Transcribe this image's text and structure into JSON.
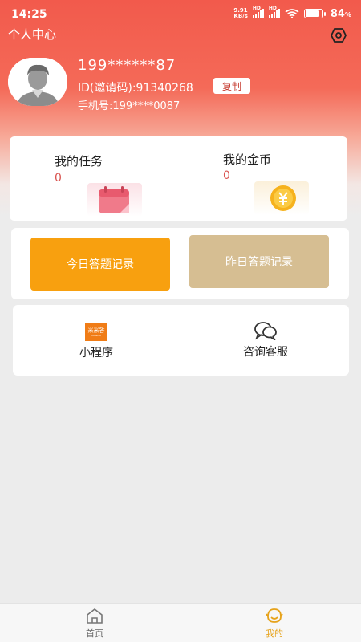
{
  "status_bar": {
    "time": "14:25",
    "net_speed_value": "9.91",
    "net_speed_unit": "KB/s",
    "signal_badge": "HD",
    "battery_percent": "84",
    "battery_unit": "%",
    "battery_level": 0.84
  },
  "header": {
    "title": "个人中心",
    "settings_icon": "settings-icon"
  },
  "profile": {
    "username": "199******87",
    "invite_id": "ID(邀请码):91340268",
    "copy_label": "复制",
    "phone": "手机号:199****0087"
  },
  "stats": {
    "tasks": {
      "label": "我的任务",
      "value": "0",
      "icon": "calendar-icon"
    },
    "coins": {
      "label": "我的金币",
      "value": "0",
      "icon": "coin-icon"
    }
  },
  "records": {
    "today_label": "今日答题记录",
    "yesterday_label": "昨日答题记录"
  },
  "tools": {
    "mini_program": {
      "label": "小程序",
      "logo_text": "米米答",
      "logo_subtext": "MIMIDA"
    },
    "consult": {
      "label": "咨询客服",
      "icon": "chat-bubbles-icon"
    }
  },
  "bottom_nav": {
    "items": [
      {
        "label": "首页",
        "icon": "home-icon",
        "active": false
      },
      {
        "label": "我的",
        "icon": "profile-face-icon",
        "active": true
      }
    ]
  },
  "colors": {
    "accent": "#f25a4c",
    "today_button": "#f8a00f",
    "yesterday_button": "#d6be92",
    "stat_value": "#d9534f",
    "nav_active": "#e6a21a",
    "nav_inactive": "#666666"
  }
}
